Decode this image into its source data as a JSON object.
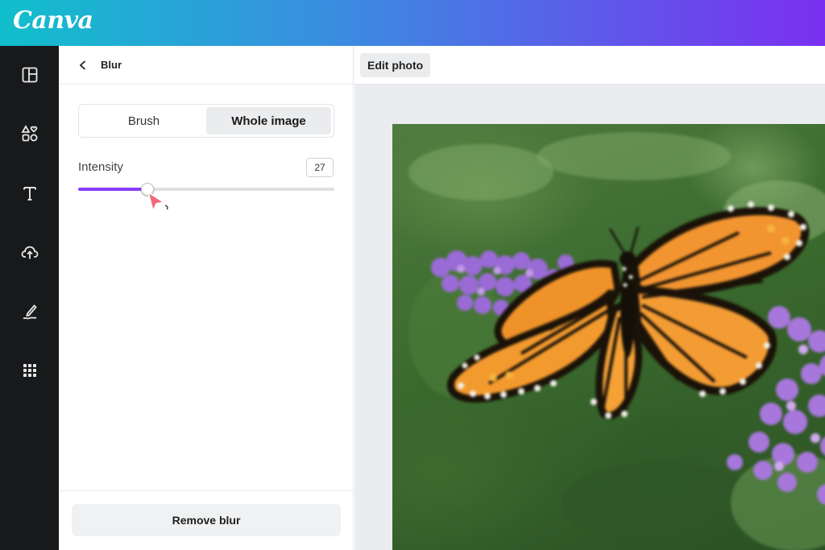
{
  "app": {
    "brand": "Canva"
  },
  "rail": {
    "items": [
      {
        "icon": "layout-icon"
      },
      {
        "icon": "elements-icon"
      },
      {
        "icon": "text-icon"
      },
      {
        "icon": "upload-icon"
      },
      {
        "icon": "draw-icon"
      },
      {
        "icon": "apps-grid-icon"
      }
    ]
  },
  "panel": {
    "title": "Blur",
    "tabs": {
      "brush": "Brush",
      "whole_image": "Whole image",
      "active": "Whole image"
    },
    "intensity": {
      "label": "Intensity",
      "value": "27",
      "fraction": 0.27
    },
    "remove_label": "Remove blur"
  },
  "toolbar": {
    "edit_photo_label": "Edit photo"
  },
  "colors": {
    "accent": "#8b3dff",
    "rail_bg": "#18191b",
    "canvas_bg": "#ebecf0"
  }
}
